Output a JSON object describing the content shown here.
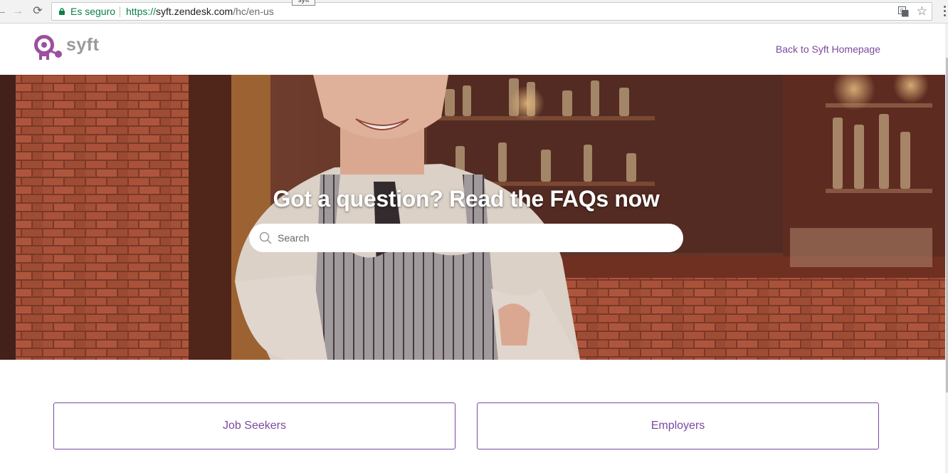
{
  "browser": {
    "secure_label": "Es seguro",
    "url_scheme": "https://",
    "url_host": "syft.zendesk.com",
    "url_path": "/hc/en-us",
    "tooltip": "syft",
    "icons": [
      "back-arrow-icon",
      "forward-arrow-icon",
      "reload-icon",
      "lock-icon",
      "translate-icon",
      "star-icon",
      "menu-icon"
    ]
  },
  "header": {
    "logo_text": "syft",
    "back_link": "Back to Syft Homepage"
  },
  "hero": {
    "title": "Got a question? Read the FAQs now",
    "search_placeholder": "Search"
  },
  "categories": [
    {
      "label": "Job Seekers"
    },
    {
      "label": "Employers"
    }
  ],
  "colors": {
    "brand_purple": "#7b4a9e",
    "logo_purple": "#9b4f9e",
    "secure_green": "#0b8043"
  }
}
